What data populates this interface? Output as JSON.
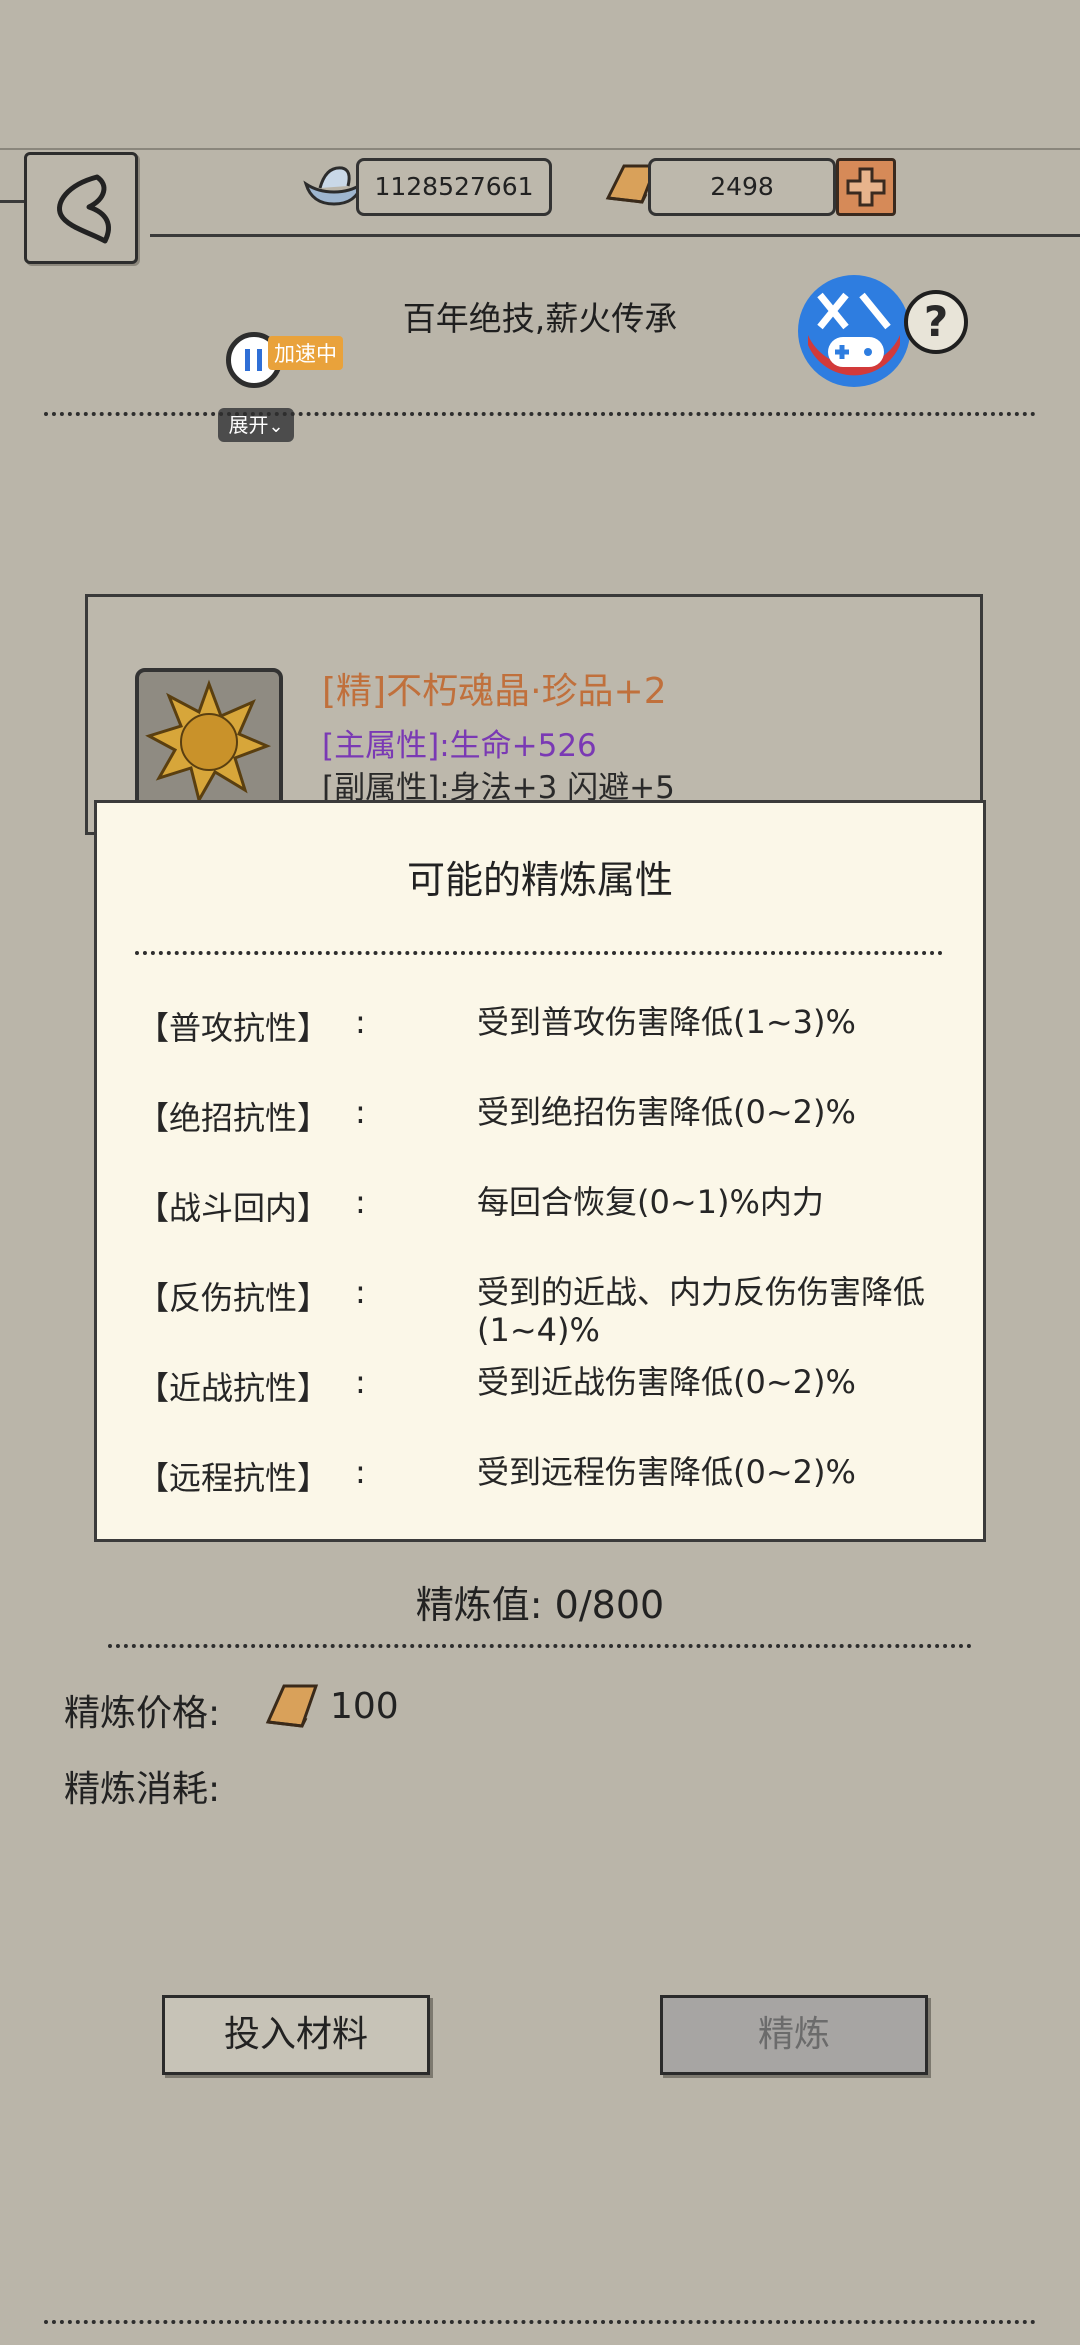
{
  "header": {
    "silver_amount": "1128527661",
    "gold_amount": "2498",
    "subtitle": "百年绝技,薪火传承"
  },
  "overlay": {
    "speed_tag": "加速中",
    "expand_label": "展开"
  },
  "item": {
    "name": "[精]不朽魂晶·珍品+2",
    "main_attr": "[主属性]:生命+526",
    "sub_attr": "[副属性]:身法+3 闪避+5"
  },
  "modal": {
    "title": "可能的精炼属性",
    "attributes": [
      {
        "name": "【普攻抗性】",
        "colon": ":",
        "desc": "受到普攻伤害降低(1~3)%"
      },
      {
        "name": "【绝招抗性】",
        "colon": ":",
        "desc": "受到绝招伤害降低(0~2)%"
      },
      {
        "name": "【战斗回内】",
        "colon": ":",
        "desc": "每回合恢复(0~1)%内力"
      },
      {
        "name": "【反伤抗性】",
        "colon": ":",
        "desc": "受到的近战、内力反伤伤害降低(1~4)%"
      },
      {
        "name": "【近战抗性】",
        "colon": ":",
        "desc": "受到近战伤害降低(0~2)%"
      },
      {
        "name": "【远程抗性】",
        "colon": ":",
        "desc": "受到远程伤害降低(0~2)%"
      }
    ]
  },
  "refine": {
    "value_label": "精炼值: 0/800",
    "price_label": "精炼价格:",
    "price_amount": "100",
    "cost_label": "精炼消耗:"
  },
  "buttons": {
    "put_material": "投入材料",
    "refine": "精炼"
  },
  "colors": {
    "background": "#bab5a9",
    "item_name": "#c0703c",
    "main_attr": "#7a39b4",
    "modal_bg": "#fbf7e8"
  }
}
